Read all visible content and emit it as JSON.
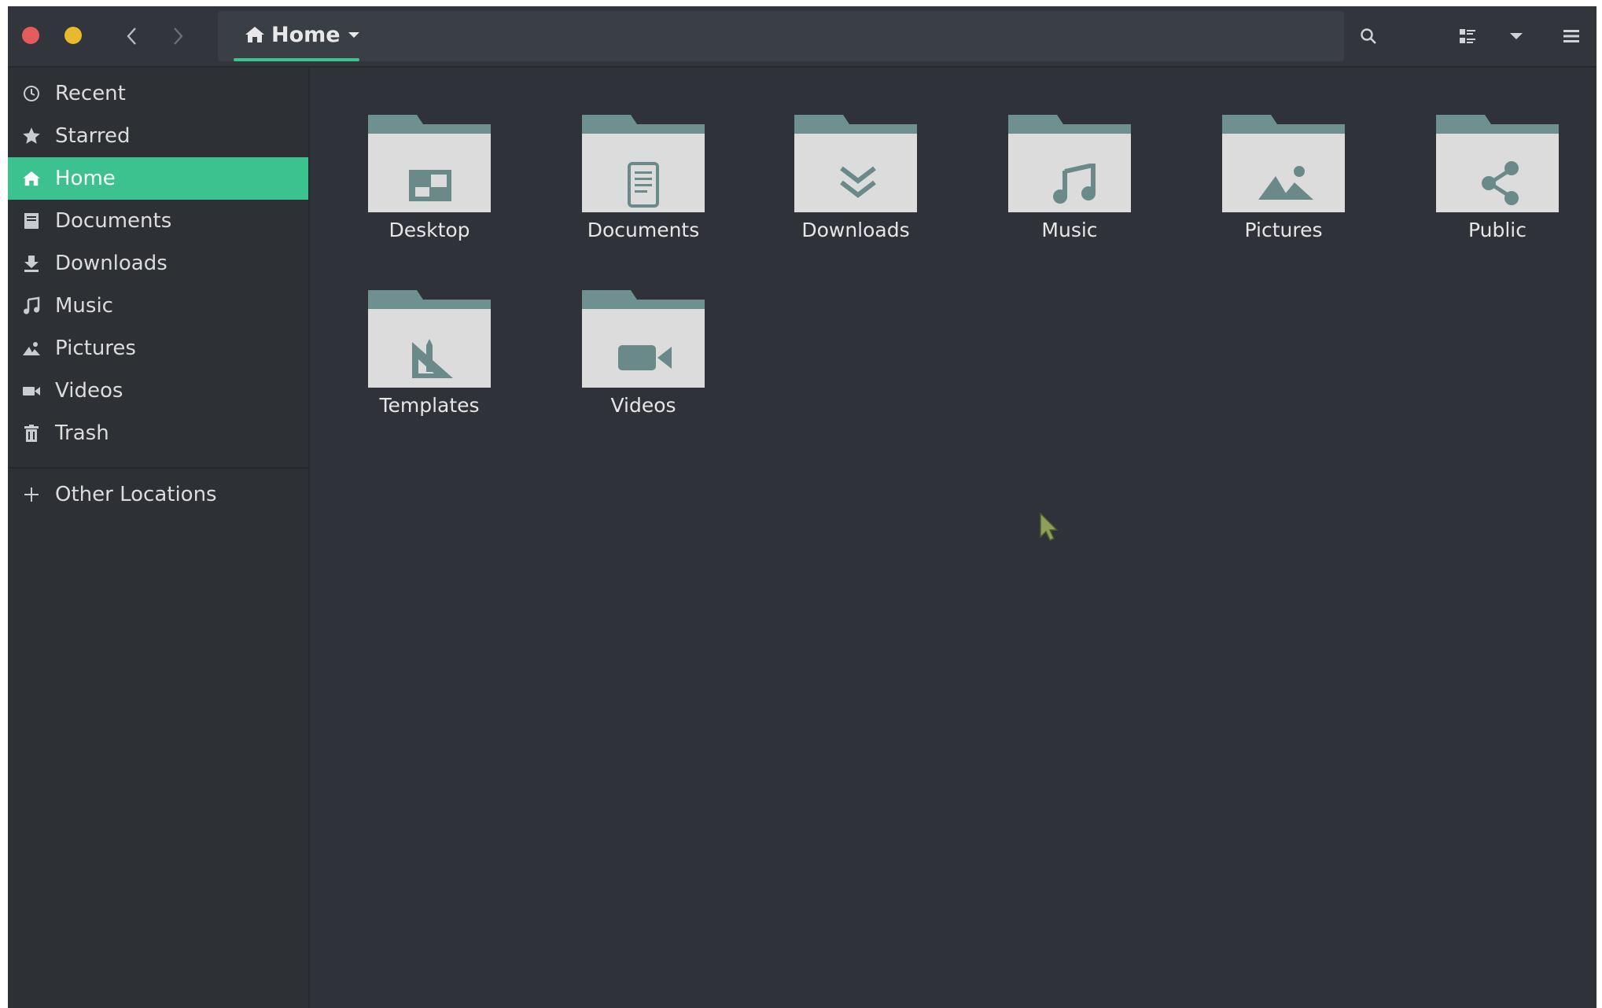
{
  "colors": {
    "accent": "#3cc28f",
    "window_bg": "#2f3238",
    "sidebar_bg": "#2d3035",
    "folder_tab": "#6f9090",
    "folder_body": "#dcdcdc",
    "folder_symbol": "#6a8a8a",
    "close": "#e35b5b",
    "minimize": "#e8b92c"
  },
  "header": {
    "path_label": "Home",
    "path_icon": "home-icon",
    "search_icon": "search-icon",
    "view_icon": "list-view-icon",
    "view_dropdown_icon": "chevron-down-icon",
    "menu_icon": "hamburger-menu-icon"
  },
  "sidebar": {
    "items": [
      {
        "label": "Recent",
        "icon": "clock-icon"
      },
      {
        "label": "Starred",
        "icon": "star-icon"
      },
      {
        "label": "Home",
        "icon": "home-icon",
        "active": true
      },
      {
        "label": "Documents",
        "icon": "document-icon"
      },
      {
        "label": "Downloads",
        "icon": "download-icon"
      },
      {
        "label": "Music",
        "icon": "music-note-icon"
      },
      {
        "label": "Pictures",
        "icon": "picture-icon"
      },
      {
        "label": "Videos",
        "icon": "video-camera-icon"
      },
      {
        "label": "Trash",
        "icon": "trash-icon"
      }
    ],
    "other_locations": {
      "label": "Other Locations",
      "icon": "plus-icon"
    }
  },
  "folders": [
    {
      "label": "Desktop",
      "icon": "desktop-icon"
    },
    {
      "label": "Documents",
      "icon": "document-icon"
    },
    {
      "label": "Downloads",
      "icon": "download-icon"
    },
    {
      "label": "Music",
      "icon": "music-note-icon"
    },
    {
      "label": "Pictures",
      "icon": "picture-icon"
    },
    {
      "label": "Public",
      "icon": "share-icon"
    },
    {
      "label": "Templates",
      "icon": "template-icon"
    },
    {
      "label": "Videos",
      "icon": "video-camera-icon"
    }
  ]
}
